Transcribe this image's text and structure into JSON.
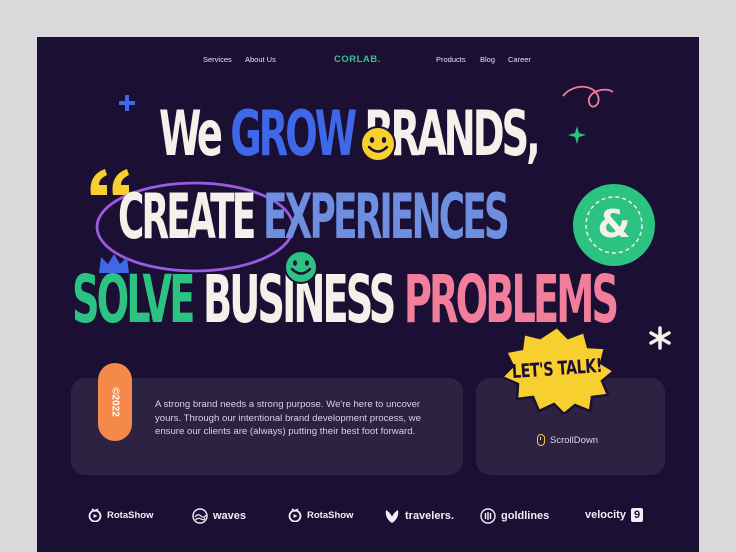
{
  "nav": {
    "left": [
      "Services",
      "About Us"
    ],
    "logo": "CORLAB.",
    "right": [
      "Products",
      "Blog",
      "Career"
    ]
  },
  "headline": {
    "line1": [
      "We",
      "GROW",
      "BRANDS,"
    ],
    "line2": [
      "CREATE",
      "EXPERIENCES"
    ],
    "line3": [
      "SOLVE",
      "BUSINESS",
      "PROBLEMS"
    ]
  },
  "ampersand": "&",
  "intro": {
    "year": "©2022",
    "text": "A strong brand needs a strong purpose. We're here to uncover yours. Through our intentional brand development process, we ensure our clients are (always) putting their best foot forward."
  },
  "cta": {
    "label": "LET'S TALK!"
  },
  "scroll": {
    "label": "ScrollDown",
    "icon": "mouse-icon"
  },
  "brands": [
    "RotaShow",
    "waves",
    "RotaShow",
    "travelers.",
    "goldlines",
    "velocity"
  ],
  "brand_badge": "9",
  "colors": {
    "background": "#1b0f33",
    "green": "#2cc281",
    "blue": "#3f68e8",
    "pink": "#f27e9b",
    "yellow": "#f7cf2e",
    "orange": "#f4894a",
    "card": "#2d2242"
  }
}
